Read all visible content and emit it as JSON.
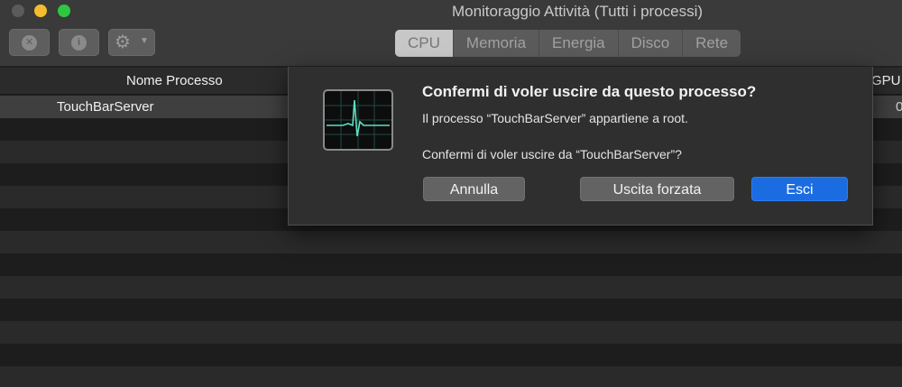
{
  "window": {
    "title": "Monitoraggio Attività (Tutti i processi)"
  },
  "toolbar": {
    "stop_icon": "x-in-circle-icon",
    "info_icon": "info-icon",
    "gear_icon": "gear-icon"
  },
  "tabs": [
    {
      "label": "CPU",
      "active": true
    },
    {
      "label": "Memoria",
      "active": false
    },
    {
      "label": "Energia",
      "active": false
    },
    {
      "label": "Disco",
      "active": false
    },
    {
      "label": "Rete",
      "active": false
    }
  ],
  "table": {
    "columns": {
      "name": "Nome Processo",
      "gpu": "GPU"
    },
    "rows": [
      {
        "name": "TouchBarServer",
        "gpu": "0"
      }
    ]
  },
  "dialog": {
    "title": "Confermi di voler uscire da questo processo?",
    "message1": "Il processo “TouchBarServer” appartiene a root.",
    "message2": "Confermi di voler uscire da “TouchBarServer”?",
    "buttons": {
      "cancel": "Annulla",
      "force_quit": "Uscita forzata",
      "quit": "Esci"
    },
    "accent_color": "#1a6ce0"
  }
}
